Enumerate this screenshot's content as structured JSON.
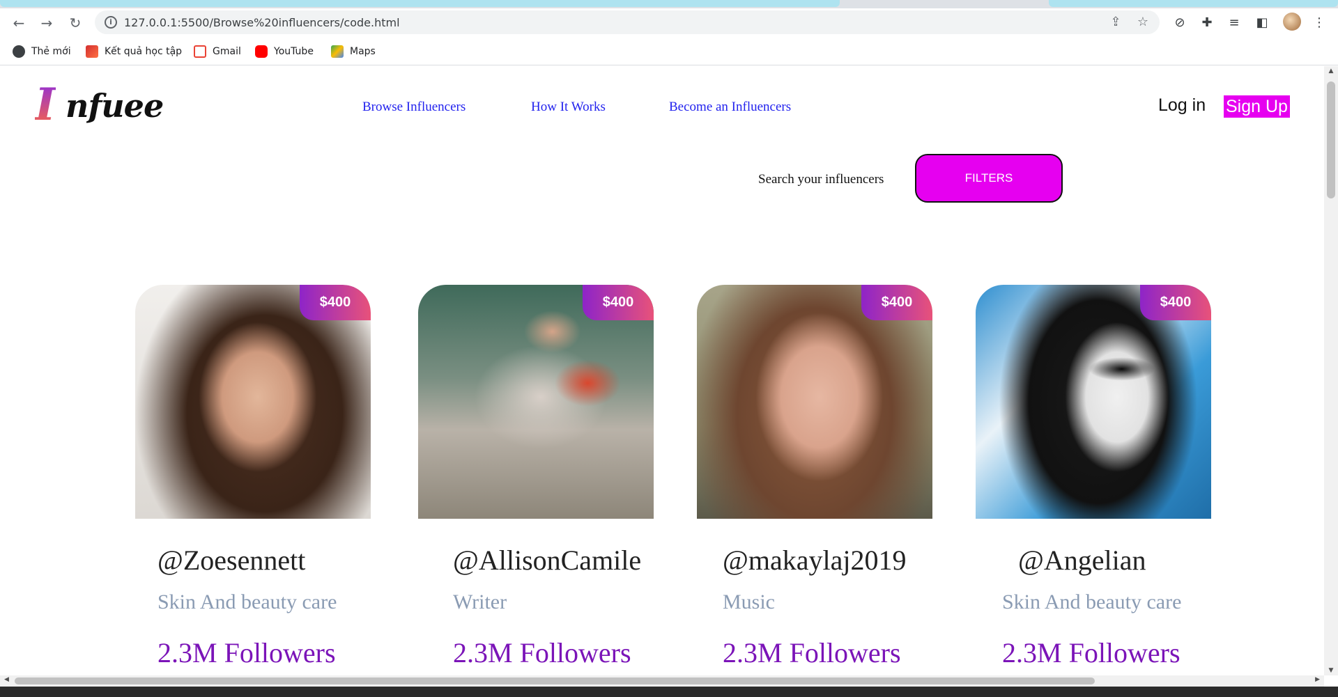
{
  "browser": {
    "url": "127.0.0.1:5500/Browse%20influencers/code.html",
    "bookmarks": [
      {
        "label": "Thẻ mới",
        "icon": "globe-icon"
      },
      {
        "label": "Kết quả học tập",
        "icon": "school-icon"
      },
      {
        "label": "Gmail",
        "icon": "gmail-icon"
      },
      {
        "label": "YouTube",
        "icon": "youtube-icon"
      },
      {
        "label": "Maps",
        "icon": "maps-icon"
      }
    ]
  },
  "header": {
    "logo_mark": "I",
    "logo_word": "nfuee",
    "nav": [
      "Browse Influencers",
      "How It Works",
      "Become an Influencers"
    ],
    "login": "Log in",
    "signup": "Sign Up"
  },
  "search": {
    "label": "Search your influencers",
    "filters": "FILTERS"
  },
  "cards": [
    {
      "handle": "@Zoesennett",
      "category": "Skin And beauty care",
      "followers": "2.3M Followers",
      "price": "$400"
    },
    {
      "handle": "@AllisonCamile",
      "category": "Writer",
      "followers": "2.3M Followers",
      "price": "$400"
    },
    {
      "handle": "@makaylaj2019",
      "category": "Music",
      "followers": "2.3M Followers",
      "price": "$400"
    },
    {
      "handle": "@Angelian",
      "category": "Skin And beauty care",
      "followers": "2.3M Followers",
      "price": "$400"
    }
  ],
  "colors": {
    "accent": "#e600f0",
    "nav_link": "#2222ee",
    "followers": "#7b14b8",
    "category": "#8a9bb3"
  }
}
